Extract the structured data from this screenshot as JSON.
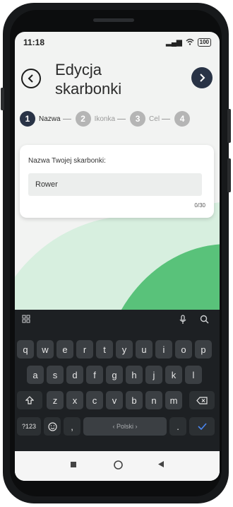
{
  "status": {
    "time": "11:18",
    "battery": "100"
  },
  "header": {
    "title": "Edycja\nskarbonki"
  },
  "steps": [
    {
      "num": "1",
      "label": "Nazwa"
    },
    {
      "num": "2",
      "label": "Ikonka"
    },
    {
      "num": "3",
      "label": "Cel"
    },
    {
      "num": "4",
      "label": ""
    }
  ],
  "form": {
    "label": "Nazwa Twojej skarbonki:",
    "value": "Rower",
    "counter": "0/30"
  },
  "keyboard": {
    "row1": [
      "q",
      "w",
      "e",
      "r",
      "t",
      "y",
      "u",
      "i",
      "o",
      "p"
    ],
    "row2": [
      "a",
      "s",
      "d",
      "f",
      "g",
      "h",
      "j",
      "k",
      "l"
    ],
    "row3": [
      "z",
      "x",
      "c",
      "v",
      "b",
      "n",
      "m"
    ],
    "symbols": "?123",
    "comma": ",",
    "space": "‹ Polski ›",
    "period": "."
  },
  "icons": {
    "back": "chevron-left-icon",
    "next": "chevron-right-icon",
    "grid": "grid-icon",
    "mic": "mic-icon",
    "search": "search-icon",
    "shift": "shift-icon",
    "backspace": "backspace-icon",
    "emoji": "emoji-icon",
    "enter": "checkmark-icon"
  },
  "colors": {
    "accent": "#293346",
    "green": "#59c27a",
    "light_green": "#d7efdf"
  }
}
